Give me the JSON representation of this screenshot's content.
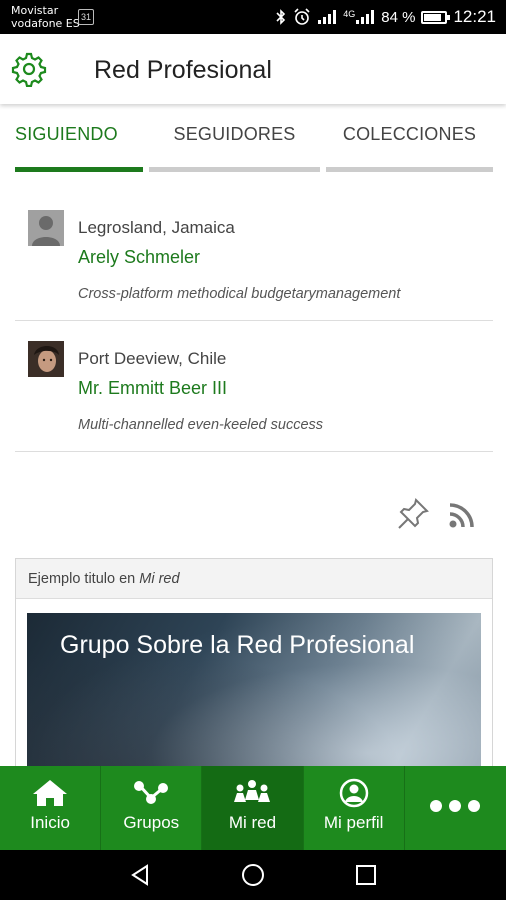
{
  "status_bar": {
    "carrier_line1": "Movistar",
    "carrier_line2": "vodafone ES",
    "sim_badge": "31",
    "signal_label": "4G",
    "battery_percent": "84 %",
    "battery_level": 0.84,
    "time": "12:21"
  },
  "app_bar": {
    "title": "Red Profesional",
    "settings_icon": "gear-icon"
  },
  "tabs": [
    {
      "label": "SIGUIENDO",
      "active": true
    },
    {
      "label": "SEGUIDORES",
      "active": false
    },
    {
      "label": "COLECCIONES",
      "active": false
    }
  ],
  "people": [
    {
      "location": "Legrosland, Jamaica",
      "name": "Arely Schmeler",
      "description": "Cross-platform methodical budgetarymanagement",
      "avatar": "default-avatar"
    },
    {
      "location": "Port Deeview, Chile",
      "name": "Mr. Emmitt Beer III",
      "description": "Multi-channelled even-keeled success",
      "avatar": "photo-avatar"
    }
  ],
  "actions": {
    "pin_icon": "pin-icon",
    "rss_icon": "rss-icon"
  },
  "card": {
    "header_prefix": "Ejemplo titulo en ",
    "header_emphasis": "Mi red",
    "image_title": "Grupo Sobre la Red Profesional"
  },
  "bottom_nav": [
    {
      "label": "Inicio",
      "icon": "home-icon",
      "active": false
    },
    {
      "label": "Grupos",
      "icon": "groups-icon",
      "active": false
    },
    {
      "label": "Mi red",
      "icon": "network-icon",
      "active": true
    },
    {
      "label": "Mi perfil",
      "icon": "profile-icon",
      "active": false
    },
    {
      "label": "",
      "icon": "more-icon",
      "active": false
    }
  ],
  "colors": {
    "accent_green": "#1d7a1d",
    "nav_green": "#1e8a1e",
    "nav_active": "#146b14"
  }
}
